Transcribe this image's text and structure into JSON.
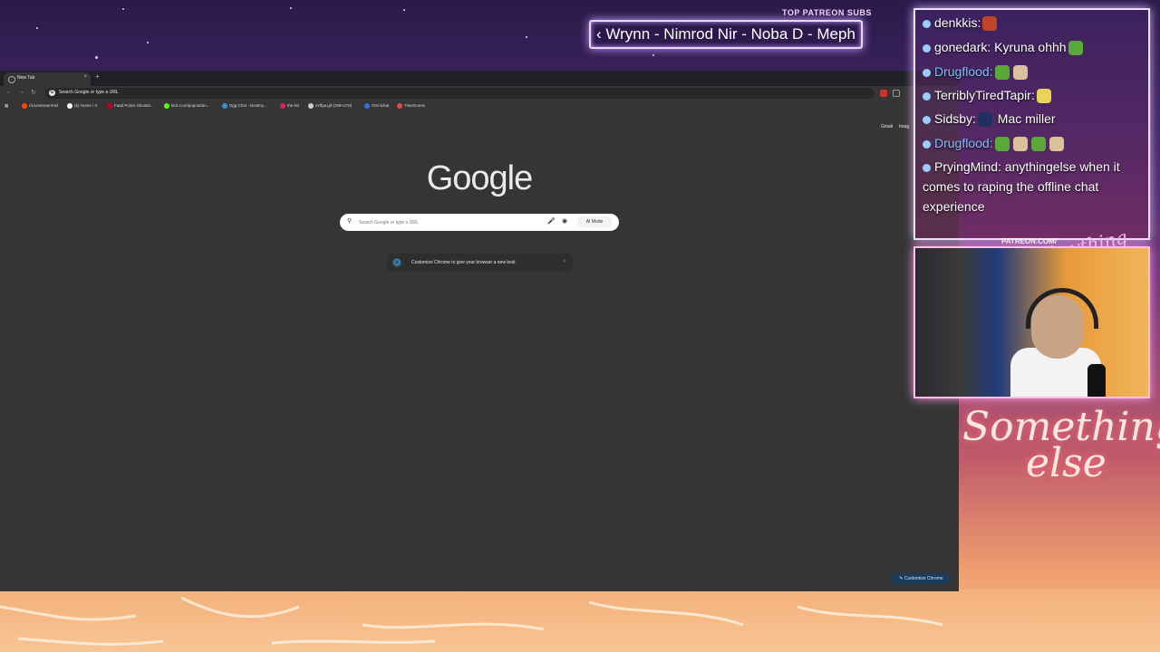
{
  "overlay": {
    "patreon_title": "TOP PATREON SUBS",
    "ticker_text": "‹ Wrynn - Nimrod Nir - Noba D - Meph",
    "patreon_link": "PATREON.COM/",
    "brand_small": "Anything else",
    "brand_big_line1": "Something",
    "brand_big_line2": "else"
  },
  "browser": {
    "tab_title": "New Tab",
    "tab_close": "×",
    "new_tab": "+",
    "omnibox_placeholder": "Search Google or type a URL",
    "bookmarks": [
      {
        "label": "r/LivestreamFail",
        "color": "#ff4500"
      },
      {
        "label": "(5) Home / X",
        "color": "#ffffff"
      },
      {
        "label": "Fatal Police Shootin...",
        "color": "#c00020"
      },
      {
        "label": "kick.com/popout/an...",
        "color": "#53fc18"
      },
      {
        "label": "Dgg Chat - Destiny...",
        "color": "#3a8fd8"
      },
      {
        "label": "the list",
        "color": "#e02060"
      },
      {
        "label": "ezffga.gif (299×278)",
        "color": "#cccccc"
      },
      {
        "label": "Omnichat",
        "color": "#3a6fd8"
      },
      {
        "label": "TimeGuess",
        "color": "#e04a4a"
      }
    ],
    "top_links": {
      "gmail": "Gmail",
      "images": "Imag"
    },
    "logo": "Google",
    "search_placeholder": "Search Google or type a URL",
    "ai_mode": "AI Mode",
    "customize_card": "Customize Chrome to give your browser a new look",
    "customize_button": "Customize Chrome"
  },
  "chat": {
    "messages": [
      {
        "user": "denkkis:",
        "text": "",
        "emotes": [
          "red"
        ],
        "blue": false
      },
      {
        "user": "gonedark:",
        "text": " Kyruna ohhh",
        "emotes": [
          "green"
        ],
        "blue": false
      },
      {
        "user": "Drugflood:",
        "text": "",
        "emotes": [
          "green",
          "hand"
        ],
        "blue": true
      },
      {
        "user": "TerriblyTiredTapir:",
        "text": "",
        "emotes": [
          "yellow"
        ],
        "blue": false
      },
      {
        "user": "Sidsby:",
        "text": " Mac miller",
        "emotes": [
          "person"
        ],
        "blue": false
      },
      {
        "user": "Drugflood:",
        "text": "",
        "emotes": [
          "green",
          "hand",
          "green",
          "hand"
        ],
        "blue": true
      },
      {
        "user": "PryingMind:",
        "text": " anythingelse when it comes to raping the offline chat experience",
        "emotes": [],
        "blue": false
      }
    ]
  }
}
